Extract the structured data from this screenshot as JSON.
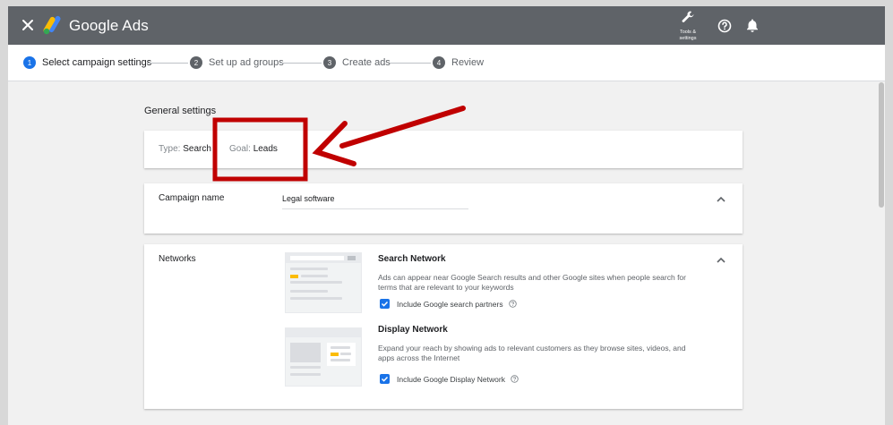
{
  "topbar": {
    "brand": "Google Ads",
    "tools_label_line1": "Tools &",
    "tools_label_line2": "settings"
  },
  "steps": [
    {
      "num": "1",
      "label": "Select campaign settings"
    },
    {
      "num": "2",
      "label": "Set up ad groups"
    },
    {
      "num": "3",
      "label": "Create ads"
    },
    {
      "num": "4",
      "label": "Review"
    }
  ],
  "general": {
    "title": "General settings",
    "type_label": "Type:",
    "type_value": "Search",
    "goal_label": "Goal:",
    "goal_value": "Leads"
  },
  "campaign": {
    "label": "Campaign name",
    "value": "Legal software"
  },
  "networks": {
    "label": "Networks",
    "search": {
      "title": "Search Network",
      "desc": "Ads can appear near Google Search results and other Google sites when people search for terms that are relevant to your keywords",
      "checkbox_label": "Include Google search partners"
    },
    "display": {
      "title": "Display Network",
      "desc": "Expand your reach by showing ads to relevant customers as they browse sites, videos, and apps across the Internet",
      "checkbox_label": "Include Google Display Network"
    }
  },
  "colors": {
    "accent": "#1a73e8",
    "topbar": "#5f6368",
    "annotation": "#c00000"
  }
}
